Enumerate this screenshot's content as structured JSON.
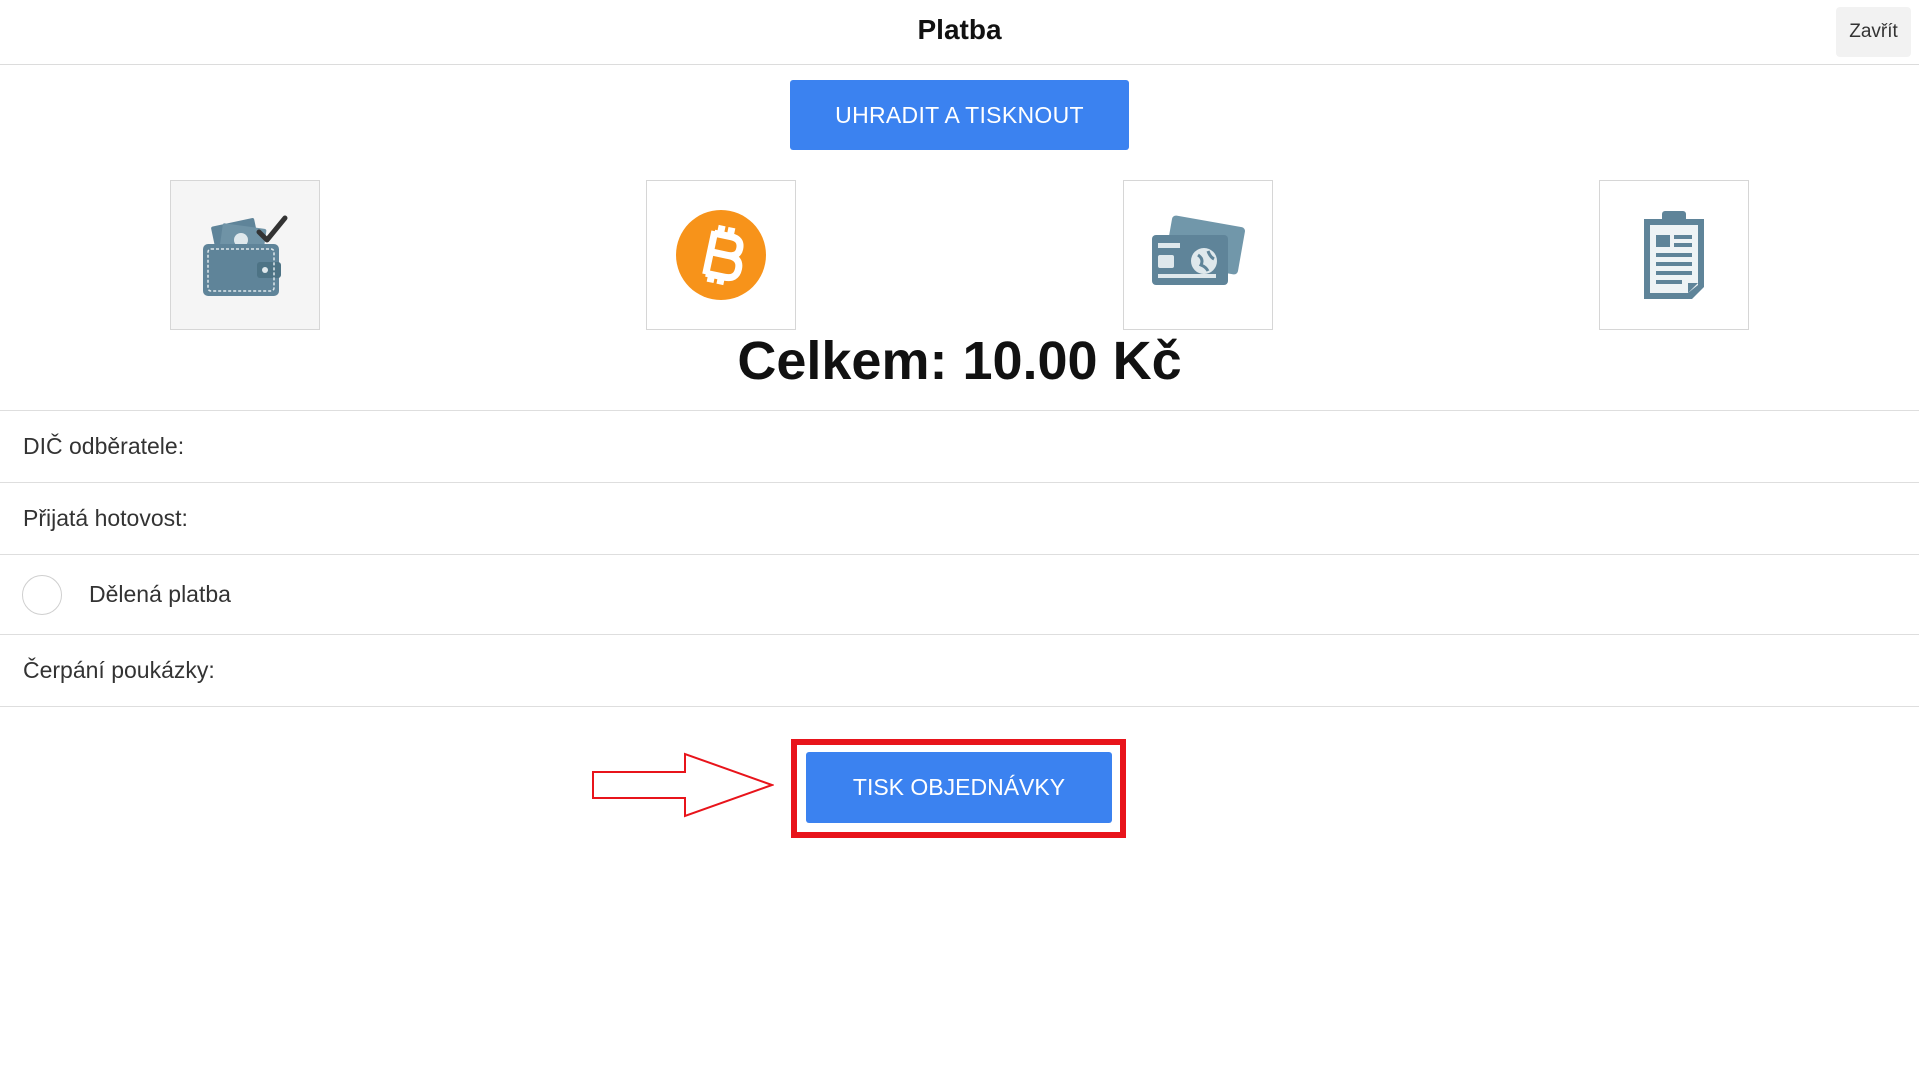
{
  "header": {
    "title": "Platba",
    "close_label": "Zavřít"
  },
  "actions": {
    "pay_and_print_label": "UHRADIT A TISKNOUT",
    "print_order_label": "TISK OBJEDNÁVKY"
  },
  "payment_methods": [
    {
      "icon": "wallet-icon",
      "selected": true
    },
    {
      "icon": "bitcoin-icon",
      "selected": false
    },
    {
      "icon": "credit-card-icon",
      "selected": false
    },
    {
      "icon": "clipboard-icon",
      "selected": false
    }
  ],
  "total": "Celkem: 10.00 Kč",
  "form": {
    "tax_id_label": "DIČ odběratele:",
    "cash_received_label": "Přijatá hotovost:",
    "split_payment_label": "Dělená platba",
    "voucher_label": "Čerpání poukázky:"
  },
  "colors": {
    "primary_button": "#3b82f0",
    "highlight": "#e8141b",
    "icon": "#5f8499",
    "bitcoin": "#f7931a"
  }
}
